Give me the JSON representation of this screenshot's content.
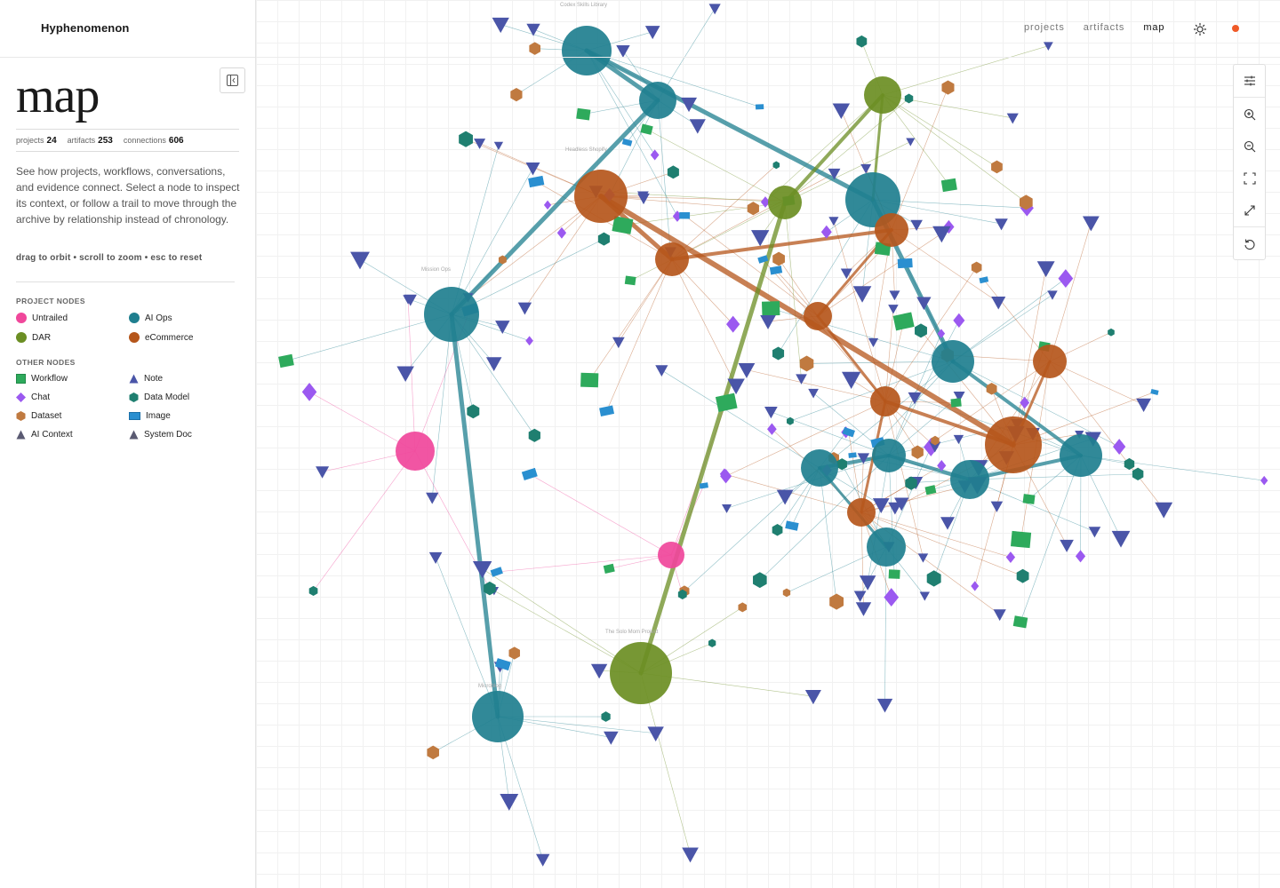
{
  "app": {
    "brand": "Hyphenomenon"
  },
  "nav": {
    "projects": "projects",
    "artifacts": "artifacts",
    "map": "map",
    "active": "map"
  },
  "sidebar": {
    "title": "map",
    "stats": {
      "projects_label": "projects",
      "projects_value": "24",
      "artifacts_label": "artifacts",
      "artifacts_value": "253",
      "connections_label": "connections",
      "connections_value": "606"
    },
    "intro": "See how projects, workflows, conversations, and evidence connect. Select a node to inspect its context, or follow a trail to move through the archive by relationship instead of chronology.",
    "hint": "drag to orbit • scroll to zoom • esc to reset",
    "project_nodes_heading": "PROJECT NODES",
    "project_nodes": [
      {
        "label": "Untrailed",
        "color": "#f0479b",
        "icon": "circle-icon"
      },
      {
        "label": "AI Ops",
        "color": "#1f7f8f",
        "icon": "circle-icon"
      },
      {
        "label": "DAR",
        "color": "#6b8e23",
        "icon": "circle-icon"
      },
      {
        "label": "eCommerce",
        "color": "#b5561b",
        "icon": "circle-icon"
      }
    ],
    "other_nodes_heading": "OTHER NODES",
    "other_nodes": [
      {
        "label": "Workflow",
        "color": "#2eaa5c",
        "icon": "square-icon"
      },
      {
        "label": "Note",
        "color": "#4a55a8",
        "icon": "triangle-icon"
      },
      {
        "label": "Chat",
        "color": "#9b59f0",
        "icon": "diamond-icon"
      },
      {
        "label": "Data Model",
        "color": "#1f7f70",
        "icon": "hexagon-icon"
      },
      {
        "label": "Dataset",
        "color": "#c07a40",
        "icon": "hexagon-icon"
      },
      {
        "label": "Image",
        "color": "#2a8fd0",
        "icon": "rectangle-icon"
      },
      {
        "label": "AI Context",
        "color": "#5a5a72",
        "icon": "triangle-icon"
      },
      {
        "label": "System Doc",
        "color": "#5a5a72",
        "icon": "triangle-icon"
      }
    ]
  },
  "graph_labels": {
    "codex": "Codex Skills Library",
    "headless": "Headless Shopify",
    "mission": "Mission Ops",
    "solo": "The Solo Mom Project",
    "microblog": "Microblog"
  },
  "toolbar": {
    "settings": "sliders-icon",
    "zoom_in": "zoom-in-icon",
    "zoom_out": "zoom-out-icon",
    "fit": "fit-view-icon",
    "expand": "expand-icon",
    "reset": "reset-icon"
  },
  "colors": {
    "untrailed": "#f0479b",
    "ai_ops": "#1f7f8f",
    "dar": "#6b8e23",
    "ecommerce": "#b5561b",
    "status_dot": "#f05a28"
  }
}
